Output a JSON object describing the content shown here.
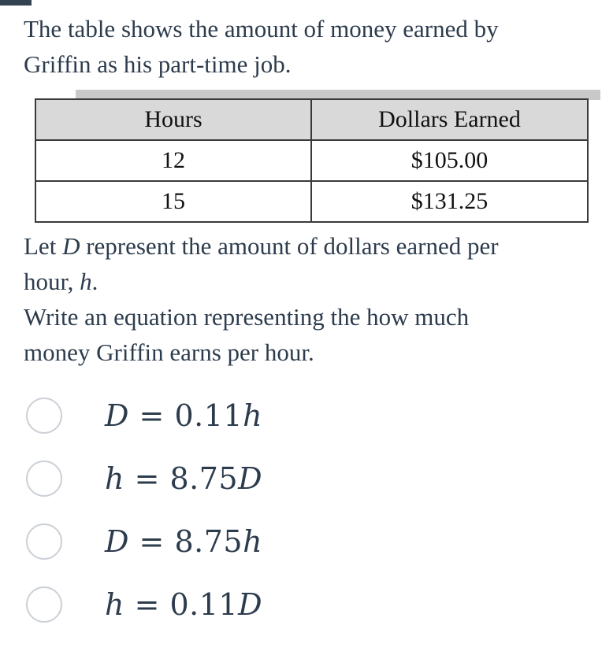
{
  "question": {
    "intro_line1": "The table shows the amount of money earned by",
    "intro_line2": "Griffin as his part-time job.",
    "let_prefix": "Let ",
    "let_var": "D",
    "let_middle": " represent the amount of dollars earned per",
    "let_line2_prefix": "hour, ",
    "let_line2_var": "h",
    "let_line2_suffix": ".",
    "prompt_line1": "Write an equation representing the how much",
    "prompt_line2": "money Griffin earns per hour."
  },
  "table": {
    "headers": [
      "Hours",
      "Dollars Earned"
    ],
    "rows": [
      [
        "12",
        "$105.00"
      ],
      [
        "15",
        "$131.25"
      ]
    ]
  },
  "choices": [
    {
      "id": "choice-a",
      "lhs": "D",
      "rel": " = ",
      "coef": "0.11",
      "rhs": "h"
    },
    {
      "id": "choice-b",
      "lhs": "h",
      "rel": " = ",
      "coef": "8.75",
      "rhs": "D"
    },
    {
      "id": "choice-c",
      "lhs": "D",
      "rel": " = ",
      "coef": "8.75",
      "rhs": "h"
    },
    {
      "id": "choice-d",
      "lhs": "h",
      "rel": " = ",
      "coef": "0.11",
      "rhs": "D"
    }
  ],
  "colors": {
    "text": "#2d3c4d",
    "table_header_bg": "#d9d9d9",
    "table_border": "#3a3a3a",
    "radio_border": "#ccd1d7",
    "top_stub": "#344352",
    "shadow_bar": "#c9c9c9"
  }
}
